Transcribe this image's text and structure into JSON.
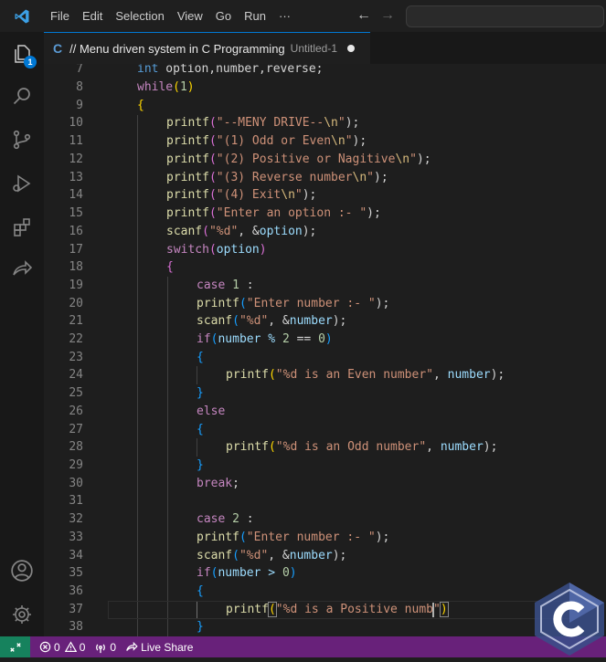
{
  "menu": [
    "File",
    "Edit",
    "Selection",
    "View",
    "Go",
    "Run",
    "···"
  ],
  "explorer_badge": "1",
  "tab": {
    "icon_letter": "C",
    "title": "// Menu driven system in C Programming",
    "description": "Untitled-1"
  },
  "line_numbers": [
    "7",
    "8",
    "9",
    "10",
    "11",
    "12",
    "13",
    "14",
    "15",
    "16",
    "17",
    "18",
    "19",
    "20",
    "21",
    "22",
    "23",
    "24",
    "25",
    "26",
    "27",
    "28",
    "29",
    "30",
    "31",
    "32",
    "33",
    "34",
    "35",
    "36",
    "37",
    "38"
  ],
  "code": {
    "l7": [
      "int",
      " option,number,reverse;"
    ],
    "l8": [
      "while",
      "(",
      "1",
      ")"
    ],
    "l9": [
      "{"
    ],
    "l10": [
      "printf",
      "(",
      "\"--MENY DRIVE--",
      "\\n",
      "\"",
      ");"
    ],
    "l11": [
      "printf",
      "(",
      "\"(1) Odd or Even",
      "\\n",
      "\"",
      ");"
    ],
    "l12": [
      "printf",
      "(",
      "\"(2) Positive or Nagitive",
      "\\n",
      "\"",
      ");"
    ],
    "l13": [
      "printf",
      "(",
      "\"(3) Reverse number",
      "\\n",
      "\"",
      ");"
    ],
    "l14": [
      "printf",
      "(",
      "\"(4) Exit",
      "\\n",
      "\"",
      ");"
    ],
    "l15": [
      "printf",
      "(",
      "\"Enter an option :- \"",
      ");"
    ],
    "l16": [
      "scanf",
      "(",
      "\"%d\"",
      ", &",
      "option",
      ");"
    ],
    "l17": [
      "switch",
      "(",
      "option",
      ")"
    ],
    "l18": [
      "{"
    ],
    "l19": [
      "case",
      " ",
      "1",
      " :"
    ],
    "l20": [
      "printf",
      "(",
      "\"Enter number :- \"",
      ");"
    ],
    "l21": [
      "scanf",
      "(",
      "\"%d\"",
      ", &",
      "number",
      ");"
    ],
    "l22": [
      "if",
      "(",
      "number % ",
      "2",
      " == ",
      "0",
      ")"
    ],
    "l23": [
      "{"
    ],
    "l24": [
      "printf",
      "(",
      "\"%d is an Even number\"",
      ", ",
      "number",
      ");"
    ],
    "l25": [
      "}"
    ],
    "l26": [
      "else"
    ],
    "l27": [
      "{"
    ],
    "l28": [
      "printf",
      "(",
      "\"%d is an Odd number\"",
      ", ",
      "number",
      ");"
    ],
    "l29": [
      "}"
    ],
    "l30": [
      "break",
      ";"
    ],
    "l31": [],
    "l32": [
      "case",
      " ",
      "2",
      " :"
    ],
    "l33": [
      "printf",
      "(",
      "\"Enter number :- \"",
      ");"
    ],
    "l34": [
      "scanf",
      "(",
      "\"%d\"",
      ", &",
      "number",
      ");"
    ],
    "l35": [
      "if",
      "(",
      "number > ",
      "0",
      ")"
    ],
    "l36": [
      "{"
    ],
    "l37": [
      "printf",
      "(",
      "\"%d is a Positive numb",
      "\"",
      ")"
    ],
    "l38": [
      "}"
    ]
  },
  "status": {
    "errors": "0",
    "warnings": "0",
    "ports": "0",
    "live_share": "Live Share"
  },
  "colors": {
    "status_bar": "#68217a",
    "remote_button": "#16825d",
    "accent": "#0078d4"
  },
  "watermark_letter": "C"
}
